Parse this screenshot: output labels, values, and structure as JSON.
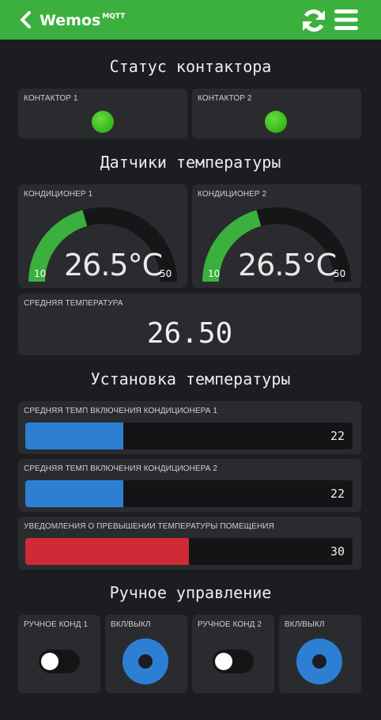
{
  "header": {
    "title": "Wemos",
    "title_sup": "MQTT",
    "back_icon": "chevron-left-icon",
    "refresh_icon": "refresh-icon",
    "menu_icon": "hamburger-menu-icon",
    "color": "#3bb03e"
  },
  "sections": {
    "contactor_status": "Статус контактора",
    "temp_sensors": "Датчики температуры",
    "temp_setting": "Установка температуры",
    "manual_control": "Ручное управление"
  },
  "contactors": [
    {
      "label": "КОНТАКТОР 1",
      "state": "on",
      "color": "#3fbf1f"
    },
    {
      "label": "КОНТАКТОР 2",
      "state": "on",
      "color": "#3fbf1f"
    }
  ],
  "gauges": [
    {
      "label": "КОНДИЦИОНЕР 1",
      "value": 26.5,
      "display": "26.5°C",
      "min": "10",
      "max": "50"
    },
    {
      "label": "КОНДИЦИОНЕР 2",
      "value": 26.5,
      "display": "26.5°C",
      "min": "10",
      "max": "50"
    }
  ],
  "gauge_colors": {
    "fill": "#3bb03e",
    "track": "#151618"
  },
  "average": {
    "label": "СРЕДНЯЯ ТЕМПЕРАТУРА",
    "value": "26.50"
  },
  "sliders": [
    {
      "label": "СРЕДНЯЯ ТЕМП ВКЛЮЧЕНИЯ КОНДИЦИОНЕРА 1",
      "value": "22",
      "fill_fraction": 0.3,
      "color": "#2d7fd3"
    },
    {
      "label": "СРЕДНЯЯ ТЕМП ВКЛЮЧЕНИЯ КОНДИЦИОНЕРА 2",
      "value": "22",
      "fill_fraction": 0.3,
      "color": "#2d7fd3"
    },
    {
      "label": "УВЕДОМЛЕНИЯ О ПРЕВЫШЕНИИ ТЕМПЕРАТУРЫ ПОМЕЩЕНИЯ",
      "value": "30",
      "fill_fraction": 0.5,
      "color": "#cf2a36"
    }
  ],
  "manual": [
    {
      "label": "РУЧНОЕ КОНД 1",
      "type": "toggle",
      "state": "off"
    },
    {
      "label": "ВКЛ/ВЫКЛ",
      "type": "button",
      "color": "#2d7fd3"
    },
    {
      "label": "РУЧНОЕ КОНД 2",
      "type": "toggle",
      "state": "off"
    },
    {
      "label": "ВКЛ/ВЫКЛ",
      "type": "button",
      "color": "#2d7fd3"
    }
  ]
}
